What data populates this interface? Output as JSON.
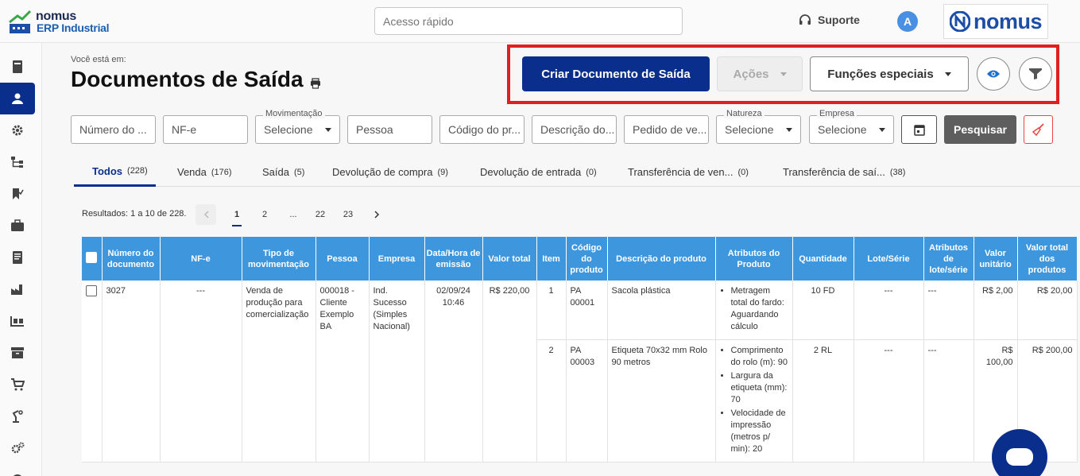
{
  "header": {
    "logo_line1": "nomus",
    "logo_line2": "ERP Industrial",
    "quick_access_placeholder": "Acesso rápido",
    "support_label": "Suporte",
    "avatar_initial": "A",
    "brand_text": "nomus"
  },
  "sidebar": {
    "items": [
      "book-icon",
      "user-icon",
      "gear-icon",
      "hierarchy-icon",
      "bookmark-check-icon",
      "briefcase-icon",
      "document-icon",
      "factory-icon",
      "conveyor-icon",
      "archive-icon",
      "cart-icon",
      "robot-arm-icon",
      "gears-icon",
      "money-icon"
    ],
    "active_index": 1
  },
  "page": {
    "breadcrumb": "Você está em:",
    "title": "Documentos de Saída"
  },
  "actions": {
    "create_label": "Criar Documento de Saída",
    "actions_label": "Ações",
    "special_label": "Funções especiais"
  },
  "filters": {
    "numero_placeholder": "Número do ...",
    "nfe_placeholder": "NF-e",
    "movimentacao_label": "Movimentação",
    "movimentacao_value": "Selecione",
    "pessoa_placeholder": "Pessoa",
    "codigo_placeholder": "Código do pr...",
    "descricao_placeholder": "Descrição do...",
    "pedido_placeholder": "Pedido de ve...",
    "natureza_label": "Natureza",
    "natureza_value": "Selecione",
    "empresa_label": "Empresa",
    "empresa_value": "Selecione",
    "search_label": "Pesquisar"
  },
  "tabs": [
    {
      "label": "Todos",
      "count": "(228)"
    },
    {
      "label": "Venda",
      "count": "(176)"
    },
    {
      "label": "Saída",
      "count": "(5)"
    },
    {
      "label": "Devolução de compra",
      "count": "(9)"
    },
    {
      "label": "Devolução de entrada",
      "count": "(0)"
    },
    {
      "label": "Transferência de ven...",
      "count": "(0)"
    },
    {
      "label": "Transferência de saí...",
      "count": "(38)"
    }
  ],
  "pagination": {
    "results": "Resultados: 1 a 10 de 228.",
    "pages": [
      "1",
      "2",
      "...",
      "22",
      "23"
    ],
    "current": "1"
  },
  "table": {
    "headers": [
      "Número do documento",
      "NF-e",
      "Tipo de movimentação",
      "Pessoa",
      "Empresa",
      "Data/Hora de emissão",
      "Valor total",
      "Item",
      "Código do produto",
      "Descrição do produto",
      "Atributos do Produto",
      "Quantidade",
      "Lote/Série",
      "Atributos de lote/série",
      "Valor unitário",
      "Valor total dos produtos"
    ],
    "document": {
      "numero": "3027",
      "nfe": "---",
      "tipo": "Venda de produção para comercialização",
      "pessoa": "000018 - Cliente Exemplo BA",
      "empresa": "Ind. Sucesso (Simples Nacional)",
      "data": "02/09/24 10:46",
      "valor_total": "R$ 220,00"
    },
    "items": [
      {
        "item": "1",
        "codigo": "PA 00001",
        "descricao": "Sacola plástica",
        "atributos": [
          "Metragem total do fardo: Aguardando cálculo"
        ],
        "quantidade": "10 FD",
        "lote": "---",
        "atributos_lote": "---",
        "valor_unitario": "R$ 2,00",
        "valor_total": "R$ 20,00"
      },
      {
        "item": "2",
        "codigo": "PA 00003",
        "descricao": "Etiqueta 70x32 mm Rolo 90 metros",
        "atributos": [
          "Comprimento do rolo (m): 90",
          "Largura da etiqueta (mm): 70",
          "Velocidade de impressão (metros p/ min): 20"
        ],
        "quantidade": "2 RL",
        "lote": "---",
        "atributos_lote": "---",
        "valor_unitario": "R$ 100,00",
        "valor_total": "R$ 200,00"
      }
    ]
  },
  "colors": {
    "primary": "#0a2e8c",
    "table_header": "#3e96dd",
    "highlight": "#e02020"
  }
}
